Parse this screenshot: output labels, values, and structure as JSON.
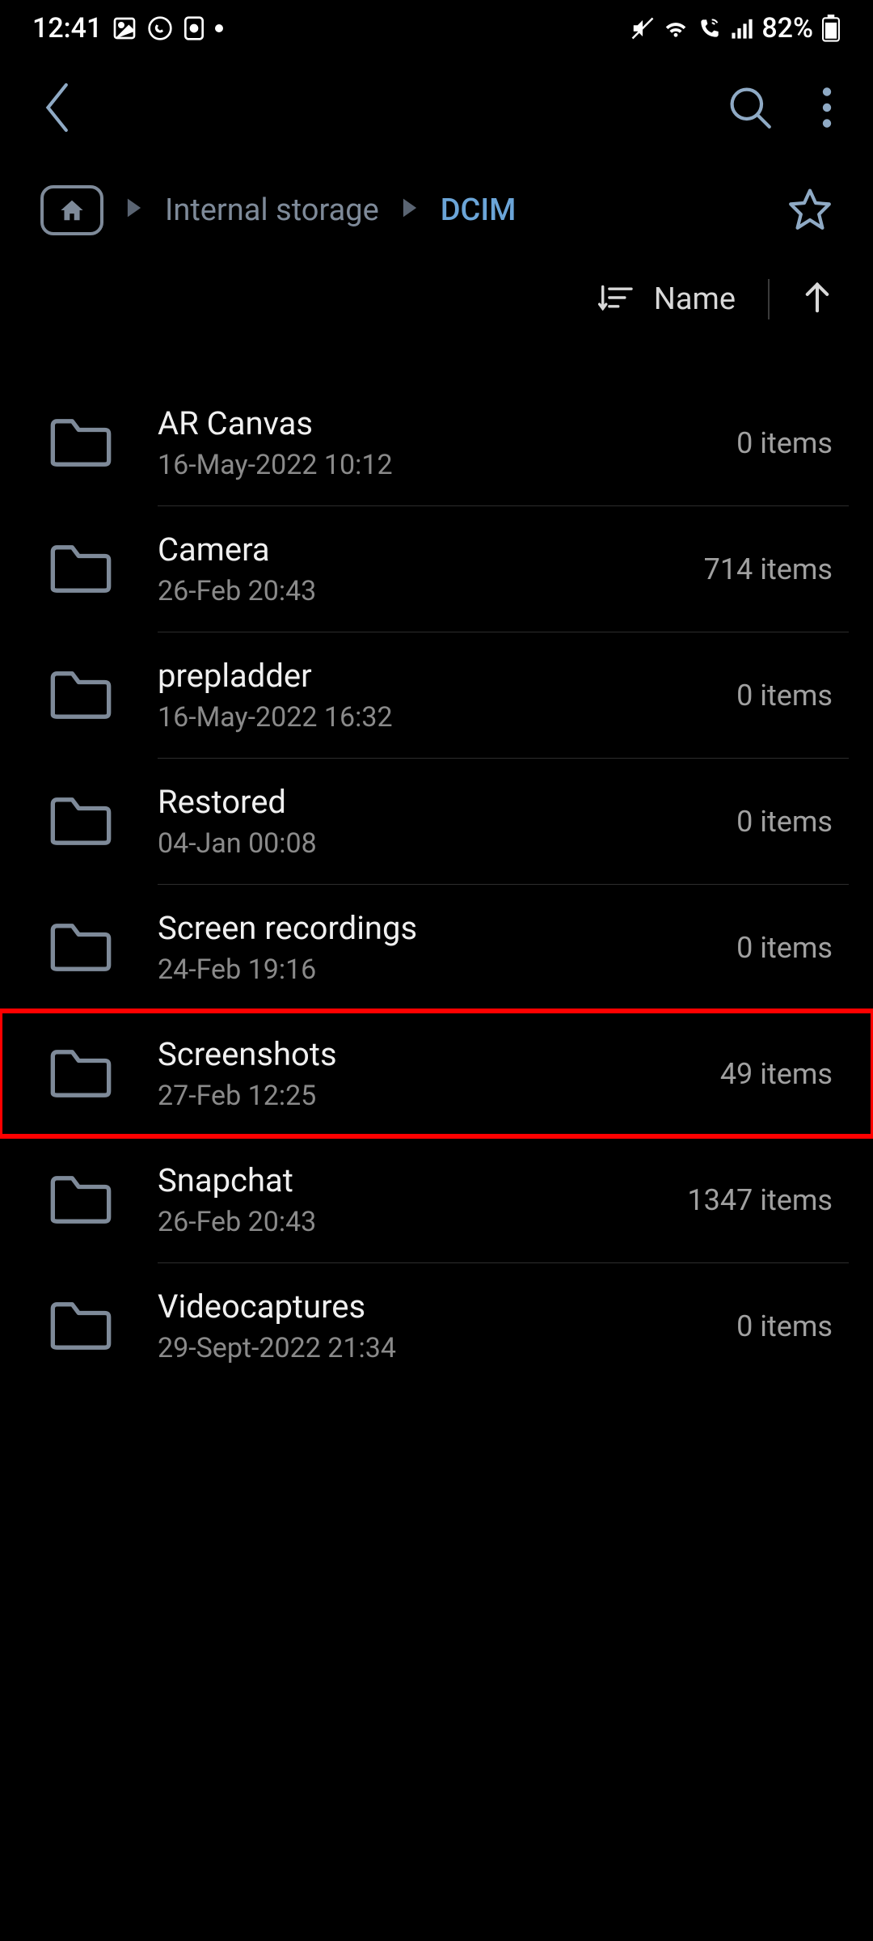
{
  "status": {
    "time": "12:41",
    "battery": "82%"
  },
  "breadcrumb": {
    "parent": "Internal storage",
    "current": "DCIM"
  },
  "sort": {
    "label": "Name"
  },
  "folders": [
    {
      "name": "AR Canvas",
      "date": "16-May-2022 10:12",
      "count": "0 items",
      "highlighted": false
    },
    {
      "name": "Camera",
      "date": "26-Feb 20:43",
      "count": "714 items",
      "highlighted": false
    },
    {
      "name": "prepladder",
      "date": "16-May-2022 16:32",
      "count": "0 items",
      "highlighted": false
    },
    {
      "name": "Restored",
      "date": "04-Jan 00:08",
      "count": "0 items",
      "highlighted": false
    },
    {
      "name": "Screen recordings",
      "date": "24-Feb 19:16",
      "count": "0 items",
      "highlighted": false
    },
    {
      "name": "Screenshots",
      "date": "27-Feb 12:25",
      "count": "49 items",
      "highlighted": true
    },
    {
      "name": "Snapchat",
      "date": "26-Feb 20:43",
      "count": "1347 items",
      "highlighted": false
    },
    {
      "name": "Videocaptures",
      "date": "29-Sept-2022 21:34",
      "count": "0 items",
      "highlighted": false
    }
  ]
}
